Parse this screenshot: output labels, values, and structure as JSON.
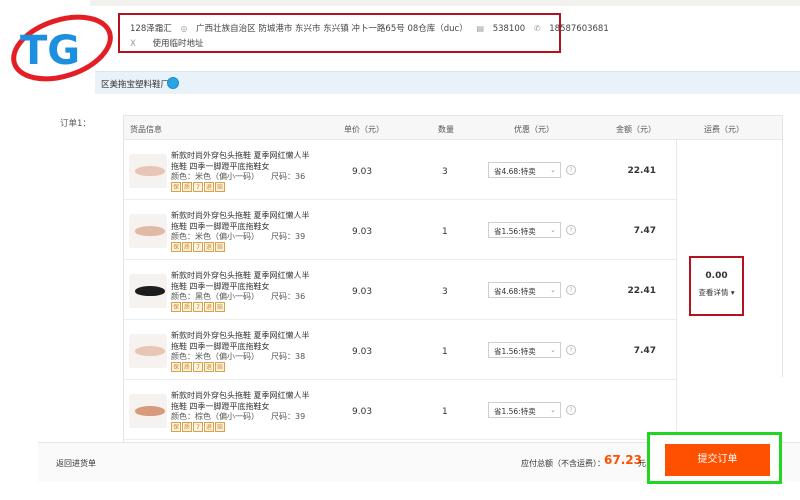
{
  "brand": {
    "logo_text": "TG",
    "logo_colors": {
      "primary": "#1d8fe1",
      "accent": "#e31e24"
    }
  },
  "address": {
    "recipient_partial": "128泽霜汇",
    "location": "广西壮族自治区 防城港市 东兴市 东兴镇 冲卜一路65号 08仓库（duc）",
    "postcode": "538100",
    "phone": "18587603681",
    "x_mark": "X",
    "temp_addr_label": "使用临时地址"
  },
  "shop": {
    "name": "区美拖宝塑料鞋厂"
  },
  "order_label": "订单1：",
  "table": {
    "headers": {
      "goods": "货品信息",
      "price": "单价（元）",
      "qty": "数量",
      "discount": "优惠（元）",
      "amount": "金额（元）",
      "shipping": "运费（元）"
    },
    "rows": [
      {
        "title": "新款时尚外穿包头拖鞋 夏季网红懒人半拖鞋 四季一脚蹬平底拖鞋女",
        "color": "颜色：米色（偏小一码）",
        "size": "尺码：36",
        "price": "9.03",
        "qty": "3",
        "discount": "省4.68:特卖",
        "amount": "22.41",
        "thumb_color": "#e8c6b6"
      },
      {
        "title": "新款时尚外穿包头拖鞋 夏季网红懒人半拖鞋 四季一脚蹬平底拖鞋女",
        "color": "颜色：米色（偏小一码）",
        "size": "尺码：39",
        "price": "9.03",
        "qty": "1",
        "discount": "省1.56:特卖",
        "amount": "7.47",
        "thumb_color": "#e2b8a6"
      },
      {
        "title": "新款时尚外穿包头拖鞋 夏季网红懒人半拖鞋 四季一脚蹬平底拖鞋女",
        "color": "颜色：黑色（偏小一码）",
        "size": "尺码：36",
        "price": "9.03",
        "qty": "3",
        "discount": "省4.68:特卖",
        "amount": "22.41",
        "thumb_color": "#1d1d1d"
      },
      {
        "title": "新款时尚外穿包头拖鞋 夏季网红懒人半拖鞋 四季一脚蹬平底拖鞋女",
        "color": "颜色：米色（偏小一码）",
        "size": "尺码：38",
        "price": "9.03",
        "qty": "1",
        "discount": "省1.56:特卖",
        "amount": "7.47",
        "thumb_color": "#e8c6b6"
      },
      {
        "title": "新款时尚外穿包头拖鞋 夏季网红懒人半拖鞋 四季一脚蹬平底拖鞋女",
        "color": "颜色：棕色（偏小一码）",
        "size": "尺码：39",
        "price": "9.03",
        "qty": "1",
        "discount": "省1.56:特卖",
        "amount": "",
        "thumb_color": "#d79a7c"
      }
    ],
    "badges": [
      "保",
      "质",
      "7",
      "退",
      "赔"
    ],
    "shipping": {
      "value": "0.00",
      "details_link": "查看详情"
    }
  },
  "footer": {
    "back_link": "返回进货单",
    "total_label": "应付总额（不含运费）：",
    "total_value": "67.23",
    "total_unit": "元",
    "submit_label": "提交订单",
    "submit_color": "#ff5000"
  }
}
